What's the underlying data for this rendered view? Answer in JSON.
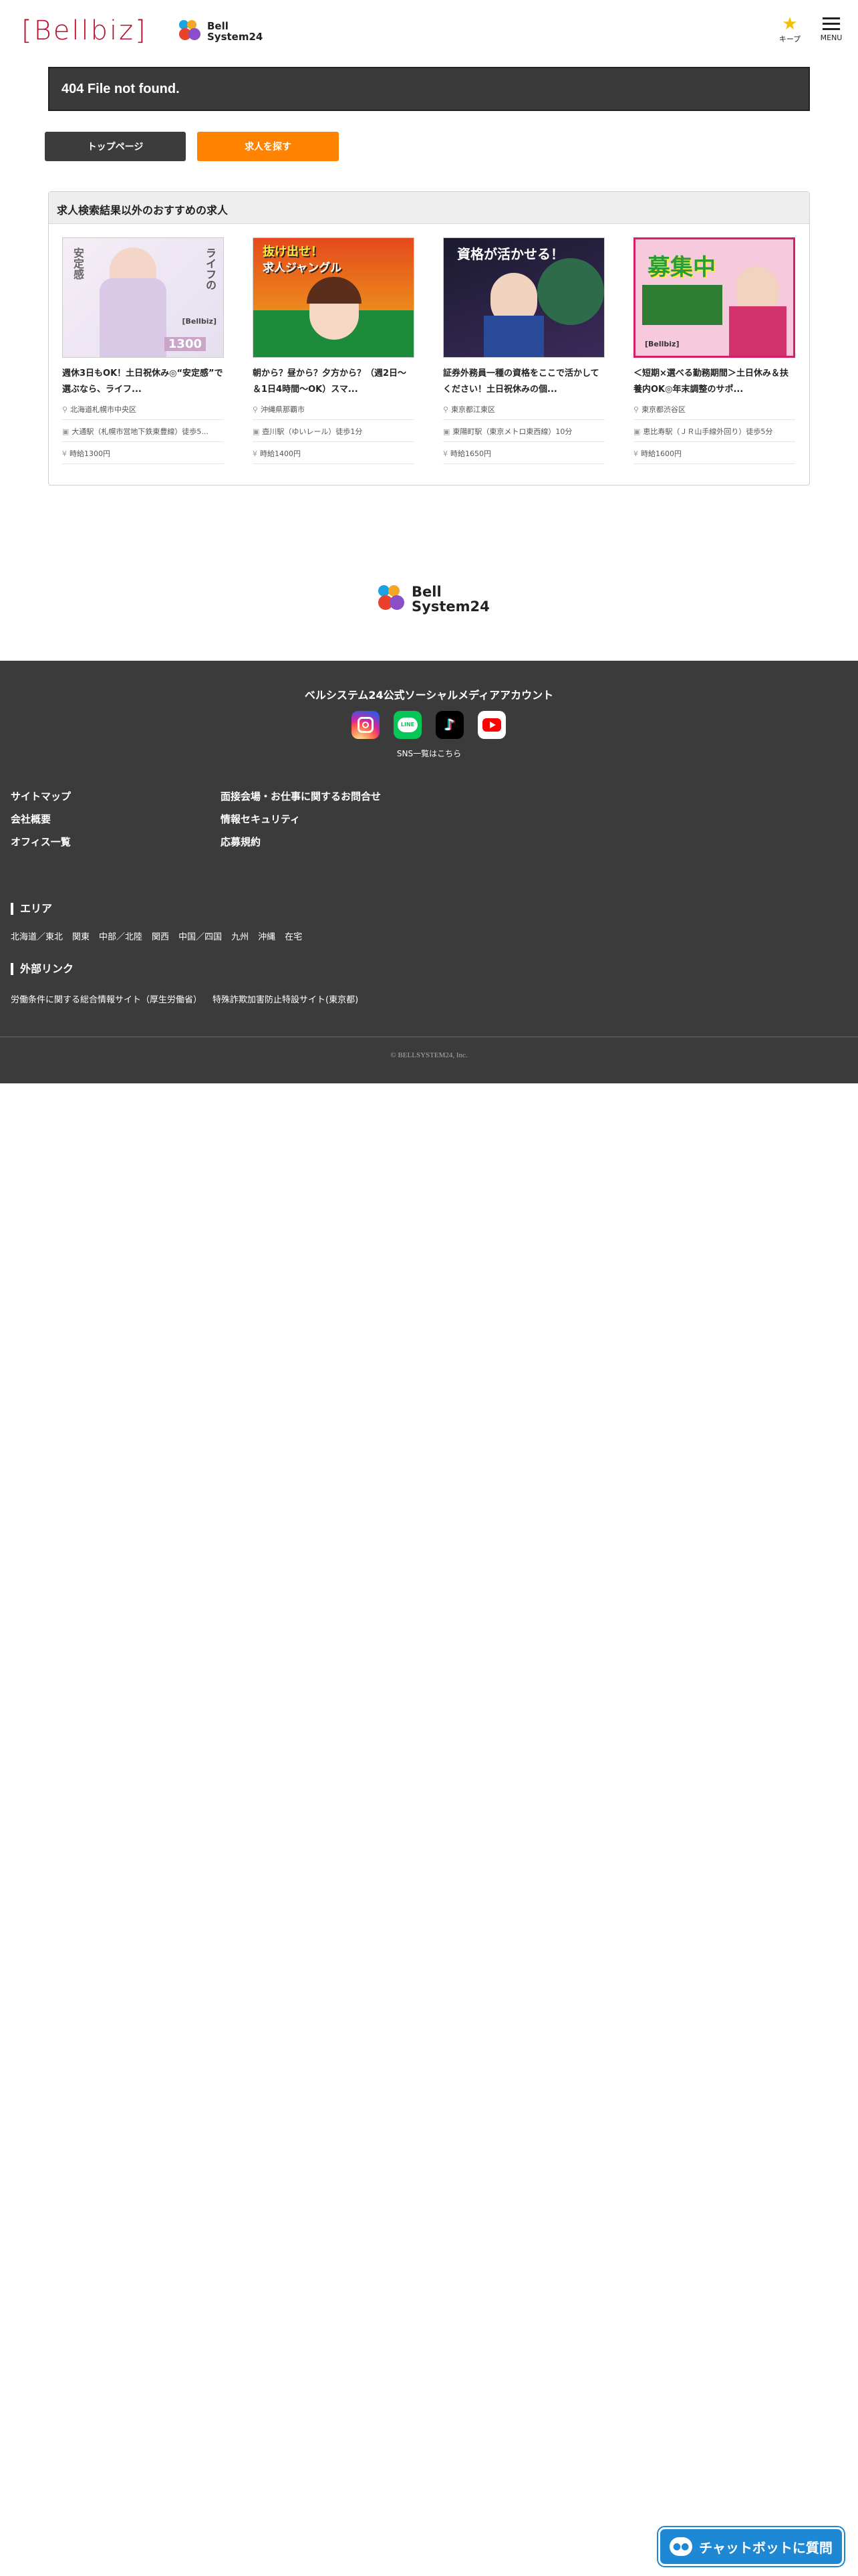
{
  "header": {
    "logo_text": "[Bellbiz]",
    "brand_line1": "Bell",
    "brand_line2": "System24",
    "keep_label": "キープ",
    "menu_label": "MENU"
  },
  "error": {
    "message": "404 File not found."
  },
  "buttons": {
    "top_page": "トップページ",
    "search_jobs": "求人を探す"
  },
  "recommend": {
    "heading": "求人検索結果以外のおすすめの求人",
    "cards": [
      {
        "title": "週休3日もOK！土日祝休み◎“安定感”で選ぶなら、ライフ...",
        "location": "北海道札幌市中央区",
        "station": "大通駅（札幌市営地下鉄東豊線）徒歩5...",
        "pay": "時給1300円",
        "image_text": [
          "ライフの",
          "安定感"
        ],
        "image_label": "[Bellbiz]",
        "image_pay": "1300"
      },
      {
        "title": "朝から？昼から？夕方から？（週2日～＆1日4時間～OK）スマ...",
        "location": "沖縄県那覇市",
        "station": "壺川駅（ゆいレール）徒歩1分",
        "pay": "時給1400円",
        "image_text": [
          "抜け出せ！",
          "求人ジャングル"
        ]
      },
      {
        "title": "証券外務員一種の資格をここで活かしてください！土日祝休みの個...",
        "location": "東京都江東区",
        "station": "東陽町駅（東京メトロ東西線）10分",
        "pay": "時給1650円",
        "image_text": [
          "資格が活かせる！"
        ]
      },
      {
        "title": "＜短期×選べる勤務期間＞土日休み＆扶養内OK◎年末調整のサポ...",
        "location": "東京都渋谷区",
        "station": "恵比寿駅（ＪＲ山手線外回り）徒歩5分",
        "pay": "時給1600円",
        "image_text": [
          "募集中"
        ],
        "image_label": "[Bellbiz]"
      }
    ]
  },
  "footer": {
    "brand_line1": "Bell",
    "brand_line2": "System24",
    "sns_title": "ベルシステム24公式ソーシャルメディアアカウント",
    "sns_icons": [
      "instagram-icon",
      "line-icon",
      "tiktok-icon",
      "youtube-icon"
    ],
    "sns_line_text": "LINE",
    "sns_link": "SNS一覧はこちら",
    "links_col1": [
      "サイトマップ",
      "会社概要",
      "オフィス一覧"
    ],
    "links_col2": [
      "面接会場・お仕事に関するお問合せ",
      "情報セキュリティ",
      "応募規約"
    ],
    "area_title": "エリア",
    "areas": [
      "北海道／東北",
      "関東",
      "中部／北陸",
      "関西",
      "中国／四国",
      "九州",
      "沖縄",
      "在宅"
    ],
    "external_title": "外部リンク",
    "external_links": [
      "労働条件に関する総合情報サイト（厚生労働省）",
      "特殊詐欺加害防止特設サイト(東京都)"
    ],
    "copyright": "© BELLSYSTEM24, Inc."
  },
  "chat": {
    "label": "チャットボットに質問"
  },
  "colors": {
    "brand_red": "#b8132e",
    "orange": "#ff8300",
    "dark": "#3b3b3b",
    "chat_blue": "#1e88d4"
  }
}
